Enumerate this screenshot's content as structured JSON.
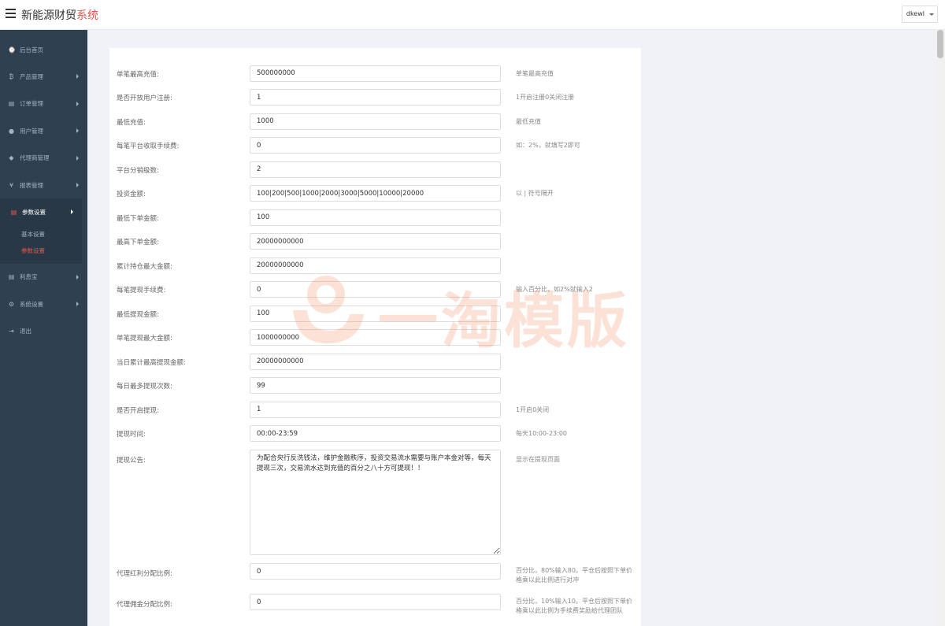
{
  "app": {
    "title_main": "新能源财贸",
    "title_accent": "系统",
    "user": "dkewl"
  },
  "sidebar": {
    "items": [
      {
        "label": "后台首页",
        "icon": "dashboard-icon",
        "glyph": "⌚"
      },
      {
        "label": "产品管理",
        "icon": "bitcoin-icon",
        "glyph": "₿"
      },
      {
        "label": "订单管理",
        "icon": "copy-icon",
        "glyph": "▤"
      },
      {
        "label": "用户管理",
        "icon": "user-icon",
        "glyph": "●"
      },
      {
        "label": "代理商管理",
        "icon": "user-tie-icon",
        "glyph": "◆"
      },
      {
        "label": "报表管理",
        "icon": "yen-icon",
        "glyph": "¥"
      }
    ],
    "active_group": {
      "label": "参数设置",
      "icon": "copy-icon",
      "glyph": "▤",
      "children": [
        {
          "label": "基本设置"
        },
        {
          "label": "参数设置"
        }
      ]
    },
    "items_after": [
      {
        "label": "利息宝",
        "icon": "copy-icon",
        "glyph": "▤"
      },
      {
        "label": "系统设置",
        "icon": "cogs-icon",
        "glyph": "⚙"
      },
      {
        "label": "退出",
        "icon": "sign-out-icon",
        "glyph": "⇥"
      }
    ]
  },
  "form": {
    "fields": [
      {
        "label": "单笔最高充值:",
        "value": "500000000",
        "hint": "单笔最高充值"
      },
      {
        "label": "是否开放用户注册:",
        "value": "1",
        "hint": "1开启注册0关闭注册"
      },
      {
        "label": "最低充值:",
        "value": "1000",
        "hint": "最低充值"
      },
      {
        "label": "每笔平台收取手续费:",
        "value": "0",
        "hint": "如：2%，就填写2即可"
      },
      {
        "label": "平台分销级数:",
        "value": "2",
        "hint": ""
      },
      {
        "label": "投资金额:",
        "value": "100|200|500|1000|2000|3000|5000|10000|20000",
        "hint": "以 | 符号隔开"
      },
      {
        "label": "最低下单金额:",
        "value": "100",
        "hint": ""
      },
      {
        "label": "最高下单金额:",
        "value": "20000000000",
        "hint": ""
      },
      {
        "label": "累计持仓最大金额:",
        "value": "20000000000",
        "hint": ""
      },
      {
        "label": "每笔提现手续费:",
        "value": "0",
        "hint": "输入百分比，如2%就输入2"
      },
      {
        "label": "最低提现金额:",
        "value": "100",
        "hint": ""
      },
      {
        "label": "单笔提现最大金额:",
        "value": "1000000000",
        "hint": ""
      },
      {
        "label": "当日累计最高提现金额:",
        "value": "20000000000",
        "hint": ""
      },
      {
        "label": "每日最多提现次数:",
        "value": "99",
        "hint": ""
      },
      {
        "label": "是否开启提现:",
        "value": "1",
        "hint": "1开启0关闭"
      },
      {
        "label": "提现时间:",
        "value": "00:00-23:59",
        "hint": "每天10:00-23:00"
      }
    ],
    "notice": {
      "label": "提现公告:",
      "value": "为配合央行反洗钱法，维护金融秩序，投资交易流水需要与账户本金对等，每天提现三次，交易流水达到充值的百分之八十方可提现！！",
      "hint": "显示在提现页面"
    },
    "fields_after": [
      {
        "label": "代理红利分配比例:",
        "value": "0",
        "hint": "百分比，80%输入80。平仓后按照下单价格乘以此比例进行对冲"
      },
      {
        "label": "代理佣金分配比例:",
        "value": "0",
        "hint": "百分比，10%输入10。平仓后按照下单价格乘以此比例为手续费奖励给代理团队"
      }
    ]
  },
  "watermark": {
    "text": "一淘模版"
  }
}
